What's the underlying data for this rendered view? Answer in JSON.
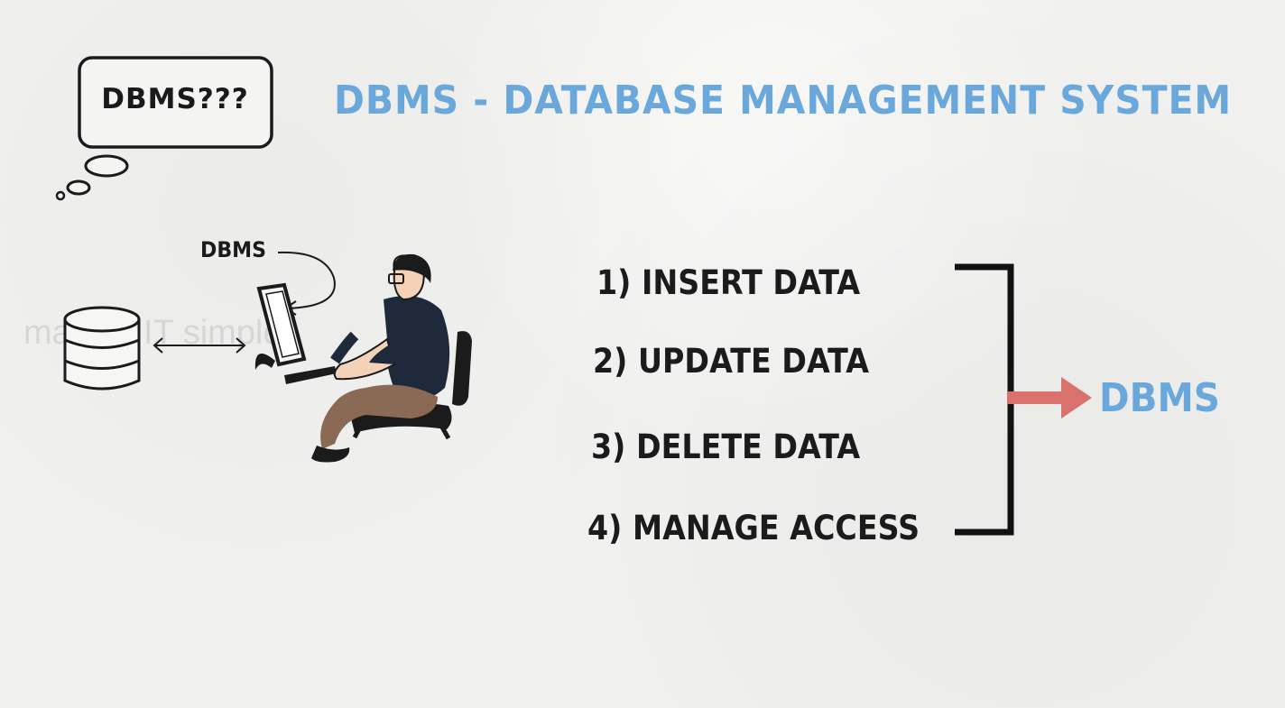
{
  "title": "DBMS - DATABASE MANAGEMENT SYSTEM",
  "thought_bubble": {
    "text": "DBMS???"
  },
  "scene": {
    "dbms_label": "DBMS",
    "watermark": "making IT simple"
  },
  "operations": [
    {
      "label": "1) INSERT DATA"
    },
    {
      "label": "2) UPDATE DATA"
    },
    {
      "label": "3) DELETE DATA"
    },
    {
      "label": "4) MANAGE ACCESS"
    }
  ],
  "result": {
    "label": "DBMS"
  },
  "colors": {
    "accent_blue": "#6aa8dc",
    "arrow_red": "#d9716c",
    "ink": "#1b1b1b",
    "background": "#f1f1ef"
  },
  "icons": [
    "database-icon",
    "computer-monitor-icon",
    "person-icon",
    "office-chair-icon",
    "thought-bubble-icon",
    "double-arrow-icon",
    "bracket-icon",
    "right-arrow-icon"
  ]
}
